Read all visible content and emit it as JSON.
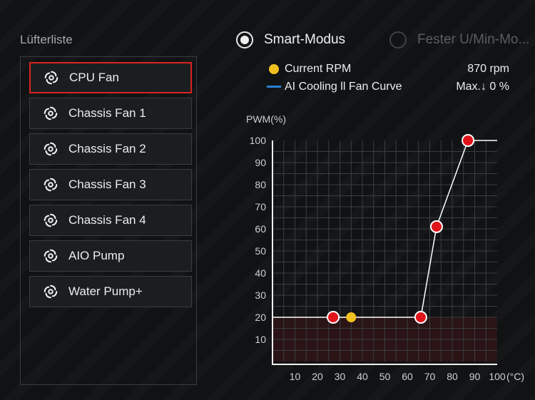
{
  "fan_list": {
    "title": "Lüfterliste",
    "items": [
      {
        "label": "CPU Fan",
        "active": true
      },
      {
        "label": "Chassis Fan 1",
        "active": false
      },
      {
        "label": "Chassis Fan 2",
        "active": false
      },
      {
        "label": "Chassis Fan 3",
        "active": false
      },
      {
        "label": "Chassis Fan 4",
        "active": false
      },
      {
        "label": "AIO Pump",
        "active": false
      },
      {
        "label": "Water Pump+",
        "active": false
      }
    ]
  },
  "modes": {
    "smart": {
      "label": "Smart-Modus",
      "selected": true
    },
    "fixed": {
      "label": "Fester U/Min-Mo...",
      "selected": false
    }
  },
  "legend": {
    "current_rpm": {
      "label": "Current RPM",
      "value": "870 rpm",
      "color": "#f0c020"
    },
    "curve": {
      "label": "AI Cooling ll Fan Curve",
      "value": "Max.↓ 0 %",
      "color": "#2a7fd4"
    }
  },
  "chart_data": {
    "type": "line",
    "ylabel": "PWM(%)",
    "xlabel": "(°C)",
    "xlim": [
      0,
      100
    ],
    "ylim": [
      0,
      100
    ],
    "x_ticks": [
      10,
      20,
      30,
      40,
      50,
      60,
      70,
      80,
      90,
      100
    ],
    "y_ticks": [
      10,
      20,
      30,
      40,
      50,
      60,
      70,
      80,
      90,
      100
    ],
    "grid": true,
    "curve_points": [
      {
        "x": 0,
        "y": 20
      },
      {
        "x": 27,
        "y": 20
      },
      {
        "x": 66,
        "y": 20
      },
      {
        "x": 73,
        "y": 61
      },
      {
        "x": 87,
        "y": 100
      },
      {
        "x": 100,
        "y": 100
      }
    ],
    "control_points": [
      {
        "x": 27,
        "y": 20
      },
      {
        "x": 66,
        "y": 20
      },
      {
        "x": 73,
        "y": 61
      },
      {
        "x": 87,
        "y": 100
      }
    ],
    "current_point": {
      "x": 35,
      "y": 20
    },
    "min_band": 20,
    "colors": {
      "line": "#ffffff",
      "point": "#e0141a",
      "current": "#f0c020",
      "band": "#2a1416",
      "grid": "#3a3d40"
    }
  }
}
